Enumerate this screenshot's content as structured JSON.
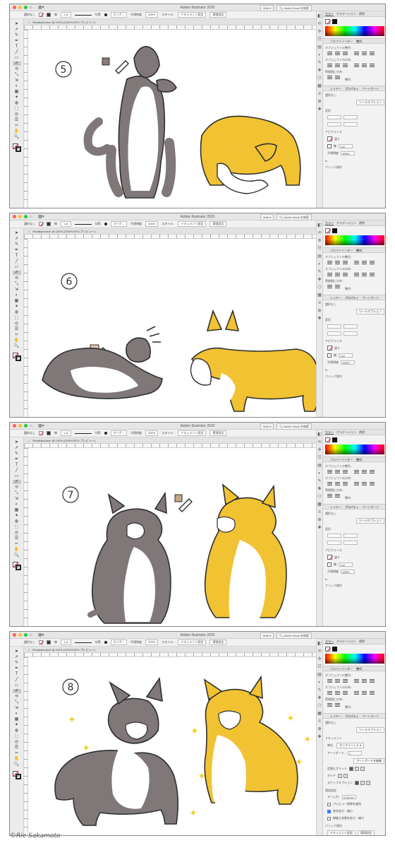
{
  "app": {
    "title": "Adobe Illustrator 2020",
    "workspace_label": "Web",
    "stock_search_label": "Adobe Stock を検索"
  },
  "control_bar": {
    "selection_label": "選択なし",
    "stroke_label": "線",
    "stroke_weight": "1 pt",
    "brush_label": "均等",
    "brush_type": "カリグ...",
    "opacity_label": "不透明度",
    "opacity_value": "100%",
    "style_label": "スタイル :",
    "doc_setup_label": "ドキュメント設定",
    "prefs_label": "環境設定"
  },
  "document": {
    "tab_title": "Redakamoica* @ 100% (CMYK/GPU プレビュー)"
  },
  "panel": {
    "tabs": [
      "カラー",
      "グラデーション",
      "透明"
    ],
    "pathfinder_tabs": [
      "パスファインダー",
      "整列"
    ],
    "align_objects_label": "オブジェクトの整列 :",
    "distribute_objects_label": "オブジェクトの分布 :",
    "distribute_spacing_label": "等間隔に分布 :",
    "align_to_label": "整列 :",
    "layer_tabs": [
      "レイヤー",
      "プロパティ",
      "アートボード"
    ],
    "no_selection": "選択なし",
    "tool_options_button": "ツールオプション",
    "transform_label": "変形",
    "appearance_label": "アピアランス",
    "fill_label": "塗り",
    "stroke_label": "線",
    "stroke_value": "1 pt",
    "opacity_label": "不透明度",
    "opacity_value": "100%",
    "fx_label": "fx.",
    "quick_actions_label": "クイック操作",
    "document_label": "ドキュメント",
    "unit_label": "単位 :",
    "unit_value": "センチメートル",
    "artboard_label": "アートボード :",
    "artboard_value": "1",
    "edit_artboard_button": "アートボードを編集",
    "ruler_grid_label": "定規とグリッド",
    "guides_label": "ガイド",
    "snap_label": "スナップオプション",
    "preferences_label": "環境設定",
    "keyboard_increment_label": "キー入力 :",
    "keyboard_increment_value": "0.03 cm",
    "preview_bounds_label": "プレビュー境界を使用",
    "scale_corners_label": "角を拡大・縮小",
    "scale_strokes_label": "線幅と効果を拡大・縮小",
    "doc_setup_button": "ドキュメント設定",
    "prefs_button": "環境設定"
  },
  "steps": [
    {
      "number": "⑤",
      "swatch_color": "#8a7a78"
    },
    {
      "number": "⑥",
      "swatch_color": "#e9c3ab"
    },
    {
      "number": "⑦",
      "swatch_color": "#c2a685"
    },
    {
      "number": "⑧",
      "swatch_color": ""
    }
  ],
  "palette": {
    "gray": "#807878",
    "gray_dark": "#5e5858",
    "yellow": "#f1c232",
    "yellow_dark": "#d9a81c",
    "white": "#ffffff",
    "outline": "#2f2f2f",
    "sparkle": "#f3cf2a"
  },
  "credit": "©Rie Sakamoto"
}
